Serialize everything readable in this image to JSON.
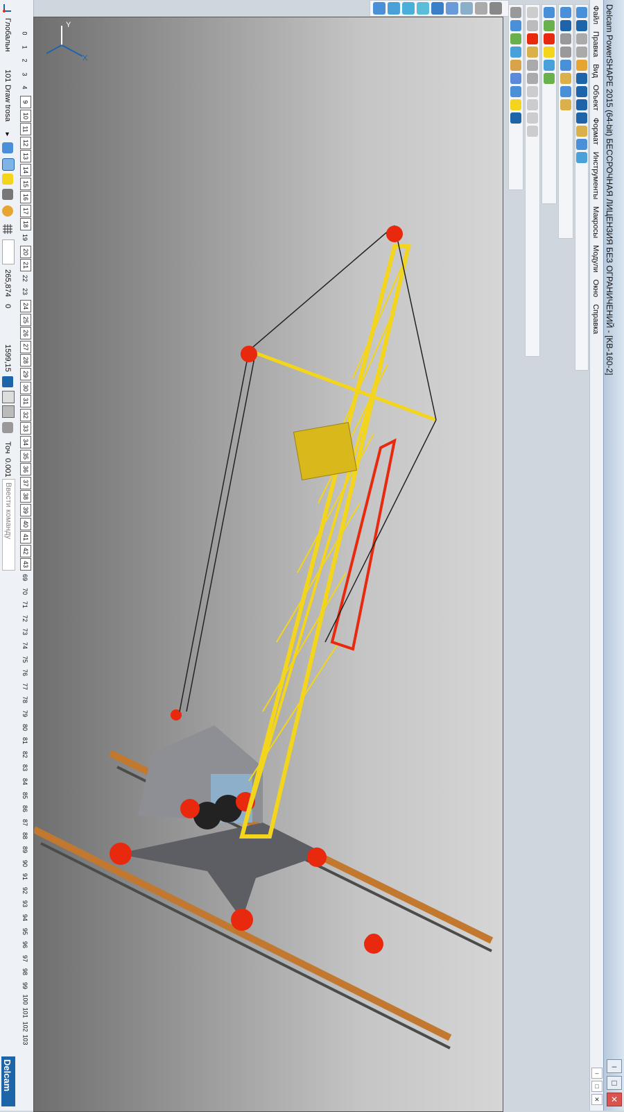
{
  "window": {
    "title": "Delcam PowerSHAPE 2015 (64-bit) БЕССРОЧНАЯ ЛИЦЕНЗИЯ БЕЗ ОГРАНИЧЕНИЙ - [KB-160-2]",
    "minimize": "–",
    "maximize": "□",
    "close": "✕"
  },
  "menu": {
    "items": [
      "Файл",
      "Правка",
      "Вид",
      "Объект",
      "Формат",
      "Инструменты",
      "Макросы",
      "Модули",
      "Окно",
      "Справка"
    ]
  },
  "workplane": {
    "mode": "Глобальн",
    "level_number": "101",
    "level_name": "Draw trosa"
  },
  "status": {
    "coord_x": "265,874",
    "coord_y": "0",
    "coord_z": "1599,15",
    "tolerance_label": "Точ",
    "tolerance_value": "0.001",
    "command_placeholder": "Ввести команду"
  },
  "levels": [
    {
      "n": "0",
      "on": false
    },
    {
      "n": "1",
      "on": false
    },
    {
      "n": "2",
      "on": false
    },
    {
      "n": "3",
      "on": false
    },
    {
      "n": "4",
      "on": false
    },
    {
      "n": "9",
      "on": true
    },
    {
      "n": "10",
      "on": true
    },
    {
      "n": "11",
      "on": true
    },
    {
      "n": "12",
      "on": true
    },
    {
      "n": "13",
      "on": true
    },
    {
      "n": "14",
      "on": true
    },
    {
      "n": "15",
      "on": true
    },
    {
      "n": "16",
      "on": true
    },
    {
      "n": "17",
      "on": true
    },
    {
      "n": "18",
      "on": true
    },
    {
      "n": "19",
      "on": false
    },
    {
      "n": "20",
      "on": true
    },
    {
      "n": "21",
      "on": true
    },
    {
      "n": "22",
      "on": false
    },
    {
      "n": "23",
      "on": false
    },
    {
      "n": "24",
      "on": true
    },
    {
      "n": "25",
      "on": true
    },
    {
      "n": "26",
      "on": true
    },
    {
      "n": "27",
      "on": true
    },
    {
      "n": "28",
      "on": true
    },
    {
      "n": "29",
      "on": true
    },
    {
      "n": "30",
      "on": true
    },
    {
      "n": "31",
      "on": true
    },
    {
      "n": "32",
      "on": true
    },
    {
      "n": "33",
      "on": true
    },
    {
      "n": "34",
      "on": true
    },
    {
      "n": "35",
      "on": true
    },
    {
      "n": "36",
      "on": true
    },
    {
      "n": "37",
      "on": true
    },
    {
      "n": "38",
      "on": true
    },
    {
      "n": "39",
      "on": true
    },
    {
      "n": "40",
      "on": true
    },
    {
      "n": "41",
      "on": true
    },
    {
      "n": "42",
      "on": true
    },
    {
      "n": "43",
      "on": true
    },
    {
      "n": "69",
      "on": false
    },
    {
      "n": "70",
      "on": false
    },
    {
      "n": "71",
      "on": false
    },
    {
      "n": "72",
      "on": false
    },
    {
      "n": "73",
      "on": false
    },
    {
      "n": "74",
      "on": false
    },
    {
      "n": "75",
      "on": false
    },
    {
      "n": "76",
      "on": false
    },
    {
      "n": "77",
      "on": false
    },
    {
      "n": "78",
      "on": false
    },
    {
      "n": "79",
      "on": false
    },
    {
      "n": "80",
      "on": false
    },
    {
      "n": "81",
      "on": false
    },
    {
      "n": "82",
      "on": false
    },
    {
      "n": "83",
      "on": false
    },
    {
      "n": "84",
      "on": false
    },
    {
      "n": "85",
      "on": false
    },
    {
      "n": "86",
      "on": false
    },
    {
      "n": "87",
      "on": false
    },
    {
      "n": "88",
      "on": false
    },
    {
      "n": "89",
      "on": false
    },
    {
      "n": "90",
      "on": false
    },
    {
      "n": "91",
      "on": false
    },
    {
      "n": "92",
      "on": false
    },
    {
      "n": "93",
      "on": false
    },
    {
      "n": "94",
      "on": false
    },
    {
      "n": "95",
      "on": false
    },
    {
      "n": "96",
      "on": false
    },
    {
      "n": "97",
      "on": false
    },
    {
      "n": "98",
      "on": false
    },
    {
      "n": "99",
      "on": false
    },
    {
      "n": "100",
      "on": false
    },
    {
      "n": "101",
      "on": false
    },
    {
      "n": "102",
      "on": false
    },
    {
      "n": "103",
      "on": false
    }
  ],
  "axes": {
    "y_label": "Y",
    "x_label": "X"
  },
  "brand": "Delcam",
  "colors": {
    "boom": "#f2d51c",
    "accent_red": "#e8290e",
    "rail": "#c2782e",
    "body_gray": "#8d8f95",
    "viewport_dark": "#6f6f6f",
    "viewport_light": "#d6d6d6",
    "brand_blue": "#1e64a8"
  }
}
